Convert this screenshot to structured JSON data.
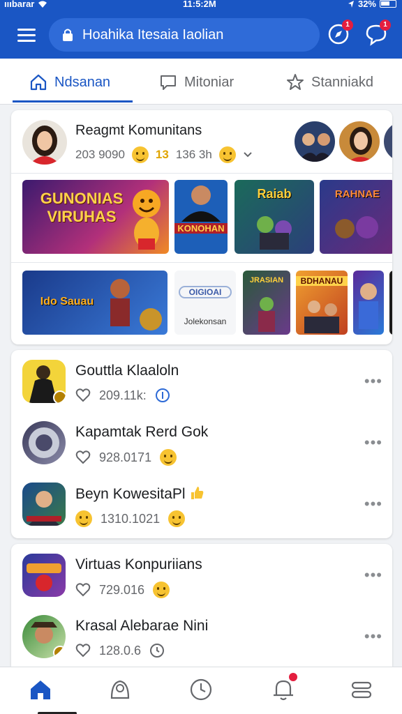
{
  "status": {
    "carrier": "ıııbarar",
    "time": "11:5:2M",
    "battery": "32%"
  },
  "header": {
    "search_text": "Hoahika Itesaia Iaolian",
    "badge_left": "1",
    "badge_right": "1"
  },
  "tabs": [
    {
      "label": "Ndsanan",
      "icon": "home-outline-icon"
    },
    {
      "label": "Mitoniar",
      "icon": "chat-bubble-icon"
    },
    {
      "label": "Stanniakd",
      "icon": "star-icon"
    }
  ],
  "featured": {
    "title": "Reagmt Komunitans",
    "members": "203 9090",
    "count": "13",
    "time": "136 3h",
    "thumbs_row1": [
      {
        "text": "GUNONIAS VIRUHAS"
      },
      {
        "text": "KONOHAN"
      },
      {
        "text": "Raiab"
      },
      {
        "text": "RAHNAE"
      }
    ],
    "thumbs_row2": [
      {
        "text": "Ido Sauau"
      },
      {
        "text": "OIGIOAI"
      },
      {
        "caption": "Jolekonsan"
      },
      {
        "text": "JRASIAN"
      },
      {
        "text": "BDHANAU"
      }
    ]
  },
  "list1": [
    {
      "title": "Gouttla Klaaloln",
      "stat": "209.11k:"
    },
    {
      "title": "Kapamtak Rerd Gok",
      "stat": "928.0171"
    },
    {
      "title": "Beyn KowesitaPl",
      "stat": "1310.1021"
    }
  ],
  "list2": [
    {
      "title": "Virtuas Konpuriians",
      "stat": "729.016"
    },
    {
      "title": "Krasal Alebarae Nini",
      "stat": "128.0.6"
    }
  ],
  "colors": {
    "brand": "#1a56c4",
    "badge": "#e41e3f"
  }
}
